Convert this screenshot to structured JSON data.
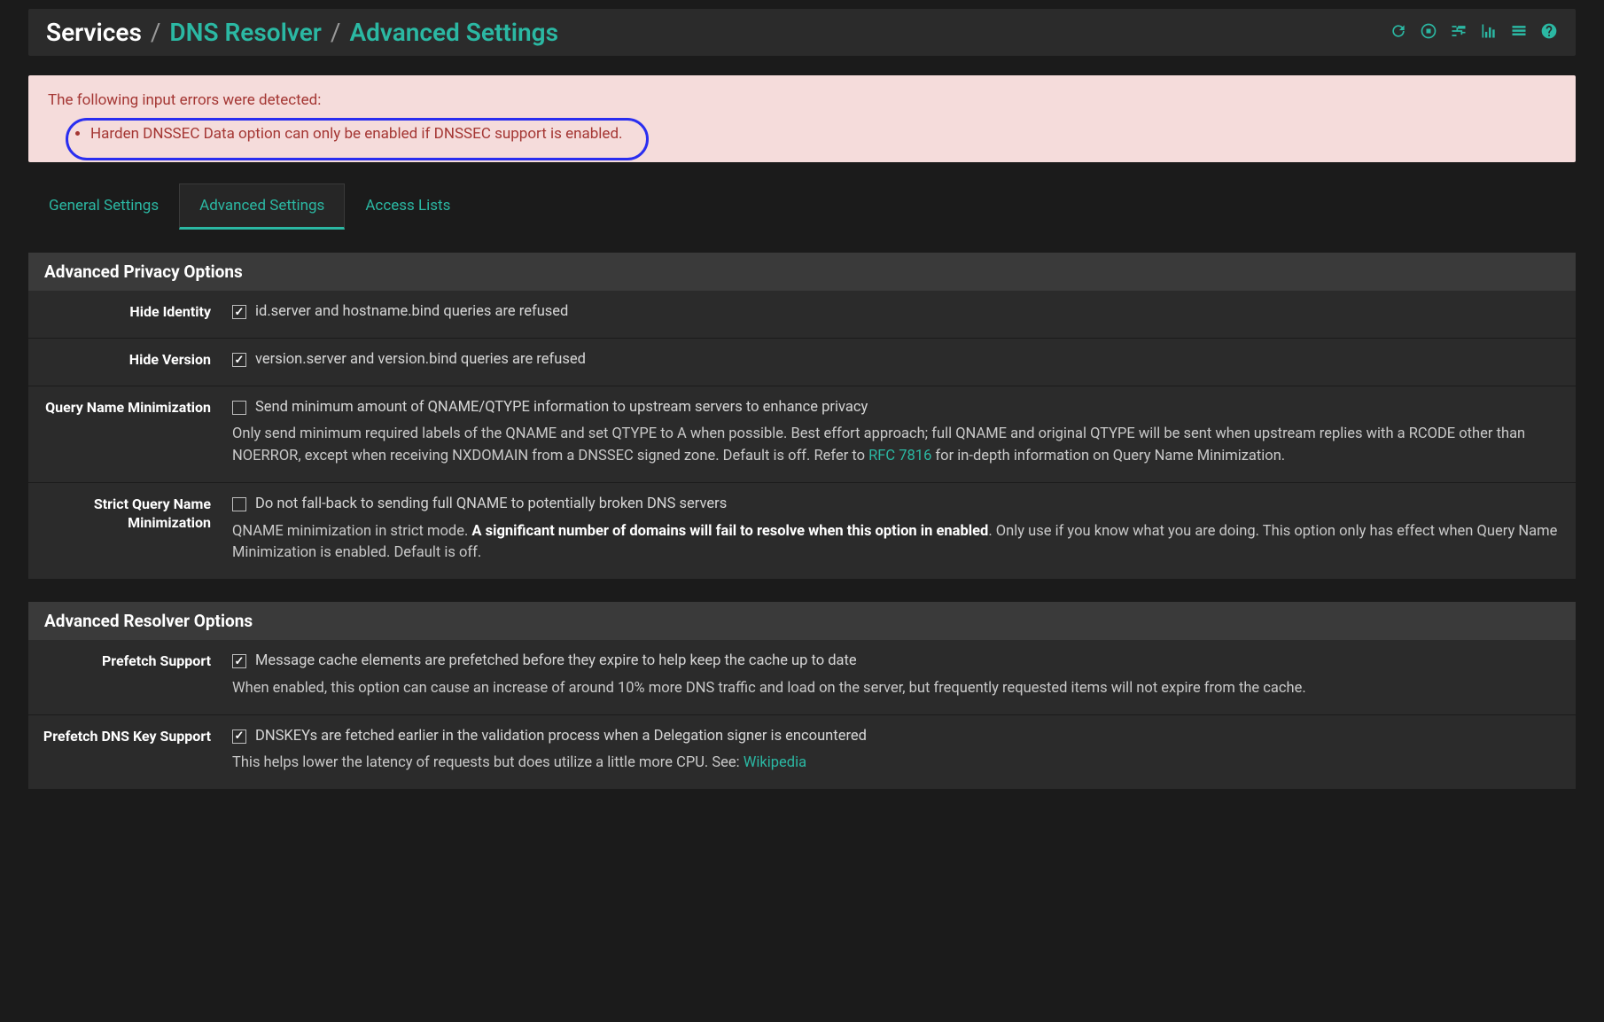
{
  "breadcrumb": {
    "root": "Services",
    "link1": "DNS Resolver",
    "link2": "Advanced Settings"
  },
  "alert": {
    "intro": "The following input errors were detected:",
    "items": [
      "Harden DNSSEC Data option can only be enabled if DNSSEC support is enabled."
    ]
  },
  "tabs": {
    "general": "General Settings",
    "advanced": "Advanced Settings",
    "access": "Access Lists"
  },
  "privacy": {
    "header": "Advanced Privacy Options",
    "hide_identity": {
      "label": "Hide Identity",
      "check_label": "id.server and hostname.bind queries are refused",
      "checked": true
    },
    "hide_version": {
      "label": "Hide Version",
      "check_label": "version.server and version.bind queries are refused",
      "checked": true
    },
    "qname_min": {
      "label": "Query Name Minimization",
      "check_label": "Send minimum amount of QNAME/QTYPE information to upstream servers to enhance privacy",
      "checked": false,
      "help_pre": "Only send minimum required labels of the QNAME and set QTYPE to A when possible. Best effort approach; full QNAME and original QTYPE will be sent when upstream replies with a RCODE other than NOERROR, except when receiving NXDOMAIN from a DNSSEC signed zone. Default is off. Refer to ",
      "help_link": "RFC 7816",
      "help_post": " for in-depth information on Query Name Minimization."
    },
    "strict_qname": {
      "label": "Strict Query Name Minimization",
      "check_label": "Do not fall-back to sending full QNAME to potentially broken DNS servers",
      "checked": false,
      "help_pre": "QNAME minimization in strict mode. ",
      "help_strong": "A significant number of domains will fail to resolve when this option in enabled",
      "help_post": ". Only use if you know what you are doing. This option only has effect when Query Name Minimization is enabled. Default is off."
    }
  },
  "resolver": {
    "header": "Advanced Resolver Options",
    "prefetch": {
      "label": "Prefetch Support",
      "check_label": "Message cache elements are prefetched before they expire to help keep the cache up to date",
      "checked": true,
      "help": "When enabled, this option can cause an increase of around 10% more DNS traffic and load on the server, but frequently requested items will not expire from the cache."
    },
    "prefetch_key": {
      "label": "Prefetch DNS Key Support",
      "check_label": "DNSKEYs are fetched earlier in the validation process when a Delegation signer is encountered",
      "checked": true,
      "help_pre": "This helps lower the latency of requests but does utilize a little more CPU. See: ",
      "help_link": "Wikipedia"
    }
  }
}
